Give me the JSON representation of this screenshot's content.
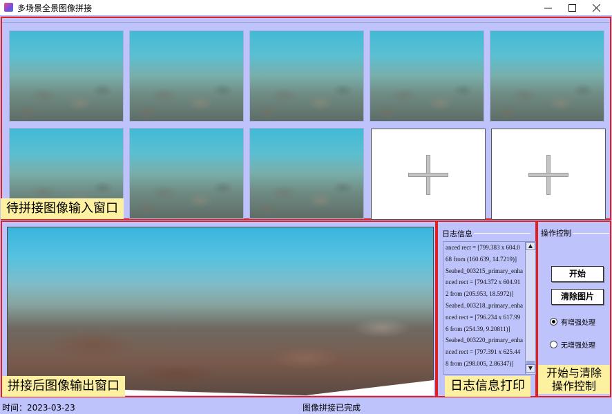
{
  "window": {
    "title": "多场景全景图像拼接",
    "min_glyph": "—",
    "max_glyph": "☐",
    "close_glyph": "✕"
  },
  "input_panel": {
    "label": "待拼接图像输入窗口",
    "tiles": [
      {
        "kind": "image",
        "icon": "underwater-photo"
      },
      {
        "kind": "image",
        "icon": "underwater-photo"
      },
      {
        "kind": "image",
        "icon": "underwater-photo"
      },
      {
        "kind": "image",
        "icon": "underwater-photo"
      },
      {
        "kind": "image",
        "icon": "underwater-photo"
      },
      {
        "kind": "image",
        "icon": "underwater-photo"
      },
      {
        "kind": "image",
        "icon": "underwater-photo"
      },
      {
        "kind": "image",
        "icon": "underwater-photo"
      },
      {
        "kind": "add",
        "icon": "plus-icon"
      },
      {
        "kind": "add",
        "icon": "plus-icon"
      }
    ]
  },
  "output_panel": {
    "label": "拼接后图像输出窗口"
  },
  "log_panel": {
    "title": "日志信息",
    "label": "日志信息打印",
    "text": "anced rect = [799.383 x 604.068 from (160.639, 14.7219)]\nSeabed_003215_primary_enhanced rect = [794.372 x 604.912 from (205.953, 18.5972)]\nSeabed_003218_primary_enhanced rect = [796.234 x 617.996 from (254.39, 9.20811)]\nSeabed_003220_primary_enhanced rect = [797.391 x 625.448 from (298.005, 2.86347)]",
    "scroll_up": "▲",
    "scroll_down": "▼"
  },
  "control_panel": {
    "title": "操作控制",
    "start_button": "开始",
    "clear_button": "清除图片",
    "radio_enhance": "有增强处理",
    "radio_no_enhance": "无增强处理",
    "selected": "有增强处理",
    "label_line1": "开始与清除",
    "label_line2": "操作控制"
  },
  "status": {
    "time": "时间：2023-03-23",
    "message": "图像拼接已完成"
  },
  "colors": {
    "background": "#bfc3fb",
    "panel_border": "#e02020",
    "label_bg": "#fdf0a0"
  }
}
